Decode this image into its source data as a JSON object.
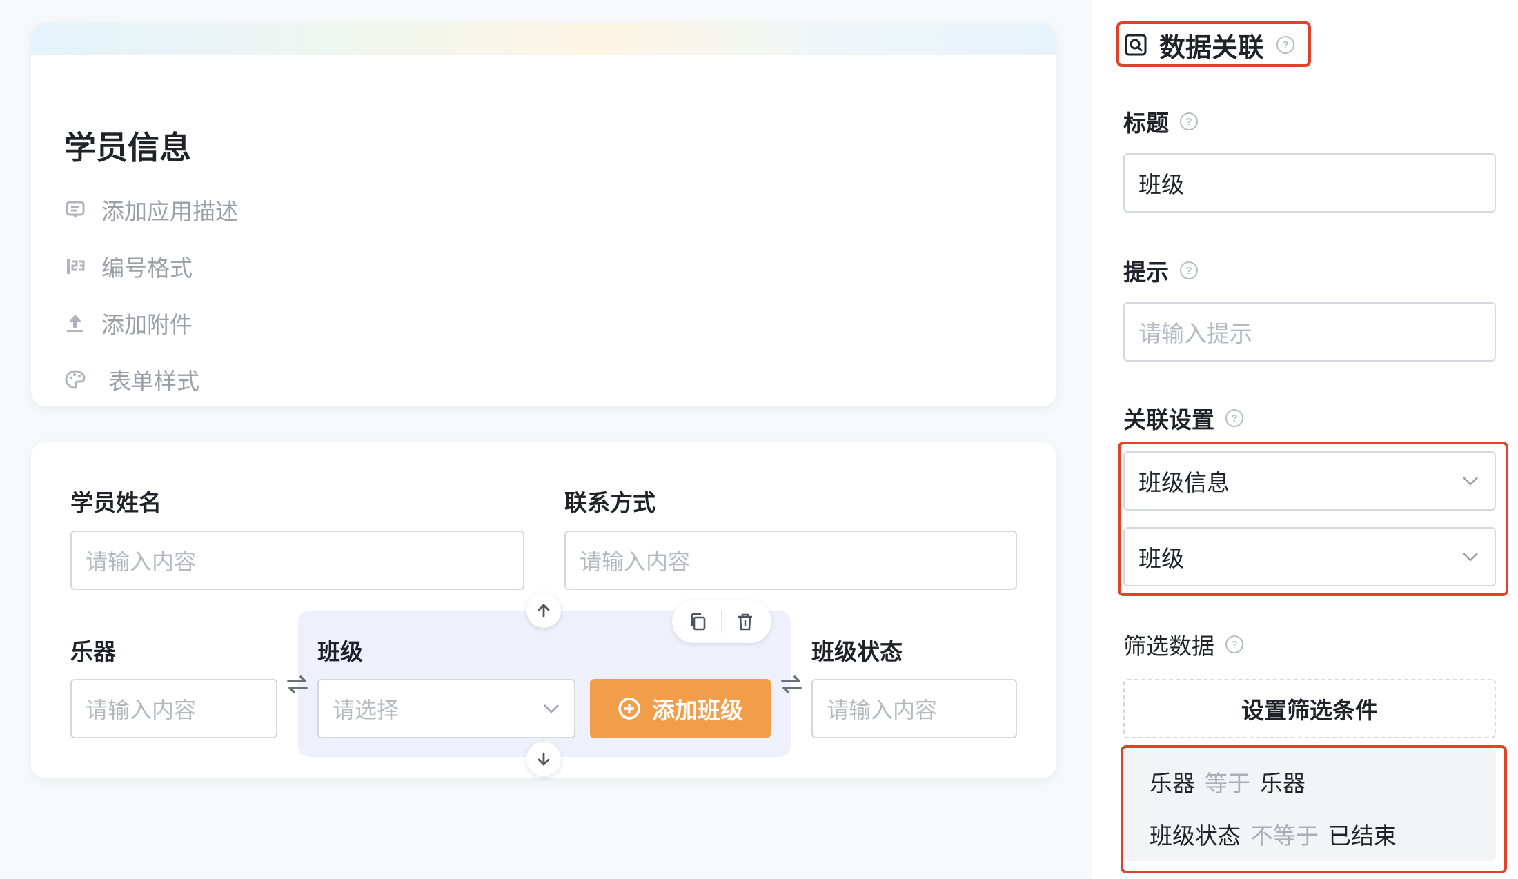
{
  "app_info": {
    "title": "学员信息",
    "options": [
      {
        "label": "添加应用描述",
        "icon": "comment-icon"
      },
      {
        "label": "编号格式",
        "icon": "number-format-icon"
      },
      {
        "label": "添加附件",
        "icon": "upload-icon"
      },
      {
        "label": "表单样式",
        "icon": "palette-icon"
      }
    ]
  },
  "form": {
    "fields": [
      {
        "label": "学员姓名",
        "placeholder": "请输入内容"
      },
      {
        "label": "联系方式",
        "placeholder": "请输入内容"
      },
      {
        "label": "乐器",
        "placeholder": "请输入内容"
      },
      {
        "label": "班级",
        "placeholder": "请选择"
      },
      {
        "label": "班级状态",
        "placeholder": "请输入内容"
      }
    ],
    "add_button": "添加班级"
  },
  "panel": {
    "title": "数据关联",
    "title_field": {
      "label": "标题",
      "value": "班级"
    },
    "hint_field": {
      "label": "提示",
      "placeholder": "请输入提示"
    },
    "relation": {
      "label": "关联设置",
      "form_value": "班级信息",
      "field_value": "班级"
    },
    "filter": {
      "label": "筛选数据",
      "button": "设置筛选条件",
      "conditions": [
        {
          "field": "乐器",
          "operator": "等于",
          "value": "乐器"
        },
        {
          "field": "班级状态",
          "operator": "不等于",
          "value": "已结束"
        }
      ]
    }
  },
  "colors": {
    "accent_orange": "#f29d4a",
    "highlight_red": "#e0432b",
    "selected_bg": "#eef1fb"
  }
}
